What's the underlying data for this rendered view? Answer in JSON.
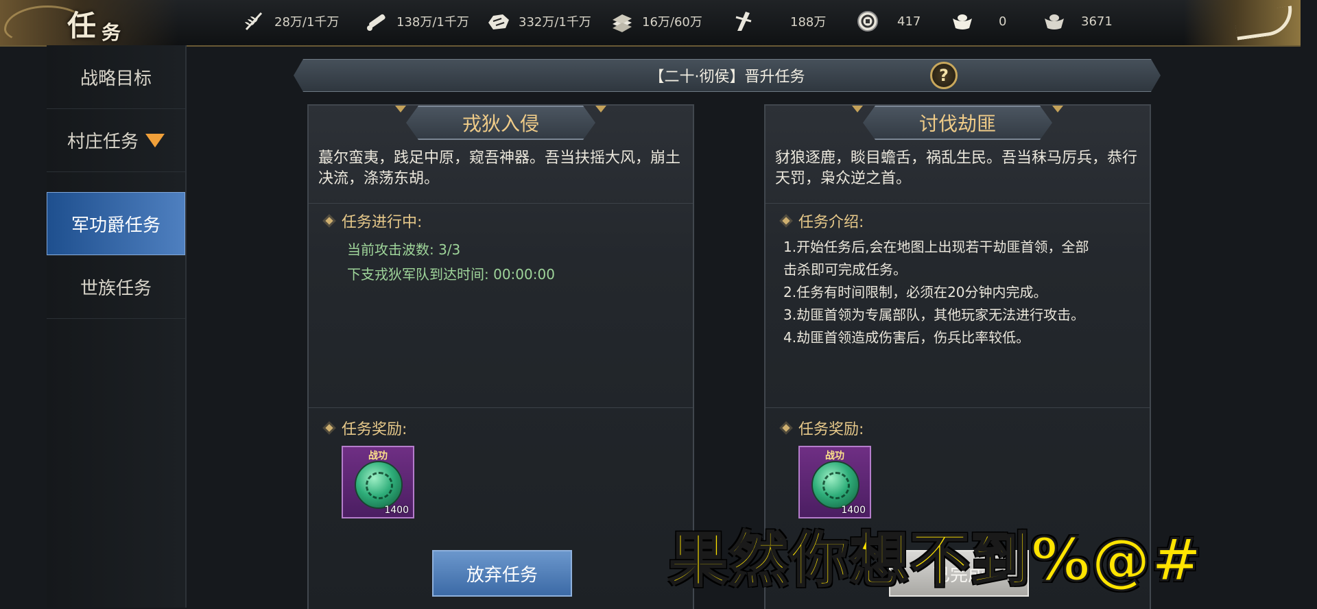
{
  "window_title_chars": [
    "任",
    "务"
  ],
  "resources": [
    {
      "icon": "grain-icon",
      "value": "28万/1千万"
    },
    {
      "icon": "wood-icon",
      "value": "138万/1千万"
    },
    {
      "icon": "stone-icon",
      "value": "332万/1千万"
    },
    {
      "icon": "iron-icon",
      "value": "16万/60万"
    },
    {
      "icon": "decree-icon",
      "value": "188万"
    },
    {
      "icon": "copper-coin-icon",
      "value": "417"
    },
    {
      "icon": "gold-ingot-icon",
      "value": "0"
    },
    {
      "icon": "silver-ingot-icon",
      "value": "3671"
    }
  ],
  "sidebar": {
    "items": [
      {
        "label": "战略目标"
      },
      {
        "label": "村庄任务"
      },
      {
        "label": "军功爵任务"
      },
      {
        "label": "世族任务"
      }
    ],
    "active_index": 2
  },
  "header": {
    "title": "【二十·彻侯】晋升任务",
    "help": "?"
  },
  "left_panel": {
    "title": "戎狄入侵",
    "description": "蕞尔蛮夷，践足中原，窥吾神器。吾当扶摇大风，崩土决流，涤荡东胡。",
    "status_title": "任务进行中:",
    "status_lines": [
      "当前攻击波数:  3/3",
      "下支戎狄军队到达时间: 00:00:00"
    ],
    "reward_title": "任务奖励:",
    "reward": {
      "label": "战功",
      "amount": "1400"
    },
    "button": "放弃任务"
  },
  "right_panel": {
    "title": "讨伐劫匪",
    "description": "豺狼逐鹿，睒目蟾舌，祸乱生民。吾当秣马厉兵，恭行天罚，枭众逆之首。",
    "intro_title": "任务介绍:",
    "intro_lines": [
      "1.开始任务后,会在地图上出现若干劫匪首领，全部",
      "击杀即可完成任务。",
      "2.任务有时间限制，必须在20分钟内完成。",
      "3.劫匪首领为专属部队，其他玩家无法进行攻击。",
      "4.劫匪首领造成伤害后，伤兵比率较低。"
    ],
    "reward_title": "任务奖励:",
    "reward": {
      "label": "战功",
      "amount": "1400"
    },
    "button": "已完成"
  },
  "overlay_caption": "果然你想不到%@#",
  "colors": {
    "accent_blue": "#3c6aa6",
    "gold": "#c9a85c",
    "green_text": "#9fd59a",
    "caption_yellow": "#ffe400"
  }
}
